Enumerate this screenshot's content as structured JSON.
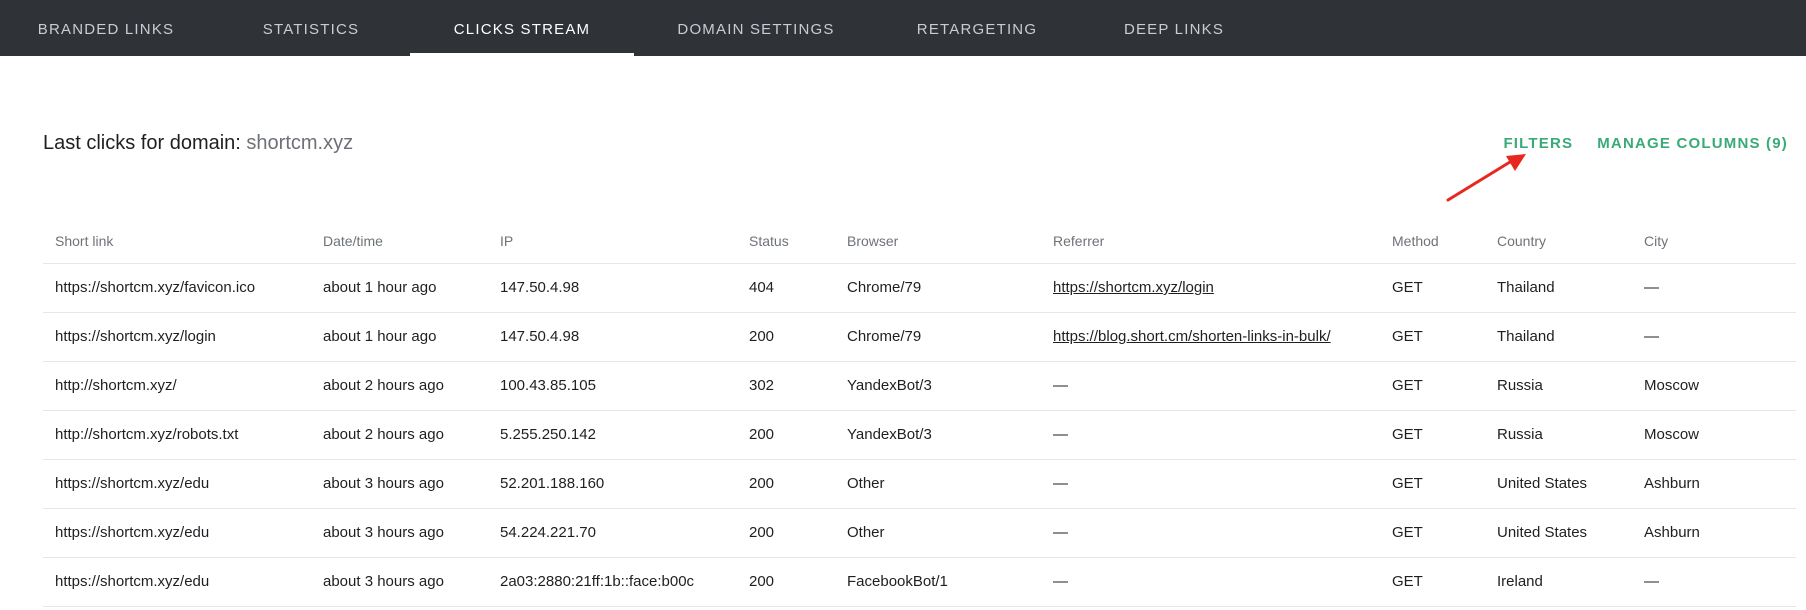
{
  "nav": {
    "tabs": [
      {
        "label": "BRANDED LINKS"
      },
      {
        "label": "STATISTICS"
      },
      {
        "label": "CLICKS STREAM"
      },
      {
        "label": "DOMAIN SETTINGS"
      },
      {
        "label": "RETARGETING"
      },
      {
        "label": "DEEP LINKS"
      }
    ],
    "active_index": 2
  },
  "header": {
    "title_prefix": "Last clicks for domain:",
    "domain": "shortcm.xyz",
    "filters_label": "FILTERS",
    "manage_columns_label": "MANAGE COLUMNS (9)"
  },
  "colors": {
    "accent": "#3aaa78",
    "nav_bg": "#2f3237",
    "annotation_arrow": "#e8271f"
  },
  "table": {
    "columns": [
      "Short link",
      "Date/time",
      "IP",
      "Status",
      "Browser",
      "Referrer",
      "Method",
      "Country",
      "City"
    ],
    "rows": [
      [
        "https://shortcm.xyz/favicon.ico",
        "about 1 hour ago",
        "147.50.4.98",
        "404",
        "Chrome/79",
        "https://shortcm.xyz/login",
        "GET",
        "Thailand",
        "—"
      ],
      [
        "https://shortcm.xyz/login",
        "about 1 hour ago",
        "147.50.4.98",
        "200",
        "Chrome/79",
        "https://blog.short.cm/shorten-links-in-bulk/",
        "GET",
        "Thailand",
        "—"
      ],
      [
        "http://shortcm.xyz/",
        "about 2 hours ago",
        "100.43.85.105",
        "302",
        "YandexBot/3",
        "—",
        "GET",
        "Russia",
        "Moscow"
      ],
      [
        "http://shortcm.xyz/robots.txt",
        "about 2 hours ago",
        "5.255.250.142",
        "200",
        "YandexBot/3",
        "—",
        "GET",
        "Russia",
        "Moscow"
      ],
      [
        "https://shortcm.xyz/edu",
        "about 3 hours ago",
        "52.201.188.160",
        "200",
        "Other",
        "—",
        "GET",
        "United States",
        "Ashburn"
      ],
      [
        "https://shortcm.xyz/edu",
        "about 3 hours ago",
        "54.224.221.70",
        "200",
        "Other",
        "—",
        "GET",
        "United States",
        "Ashburn"
      ],
      [
        "https://shortcm.xyz/edu",
        "about 3 hours ago",
        "2a03:2880:21ff:1b::face:b00c",
        "200",
        "FacebookBot/1",
        "—",
        "GET",
        "Ireland",
        "—"
      ]
    ]
  }
}
